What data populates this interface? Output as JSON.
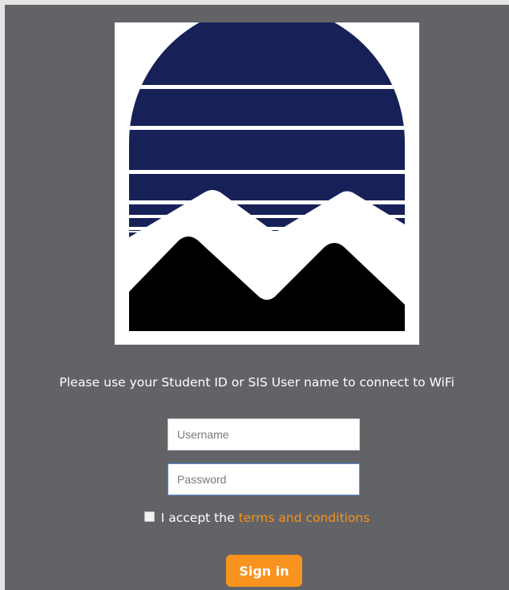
{
  "logo": {
    "name": "mountain-sunset-logo",
    "colors": {
      "sky": "#172158",
      "mountain_front": "#000000",
      "mountain_back": "#ffffff"
    }
  },
  "prompt_text": "Please use your Student ID or SIS User name to connect to WiFi",
  "form": {
    "username_placeholder": "Username",
    "password_placeholder": "Password",
    "terms_prefix": "I accept the",
    "terms_link": "terms and conditions",
    "terms_checked": false,
    "signin_label": "Sign in"
  },
  "colors": {
    "background": "#626366",
    "accent": "#f7931e",
    "focus_border": "#5b86c8"
  }
}
